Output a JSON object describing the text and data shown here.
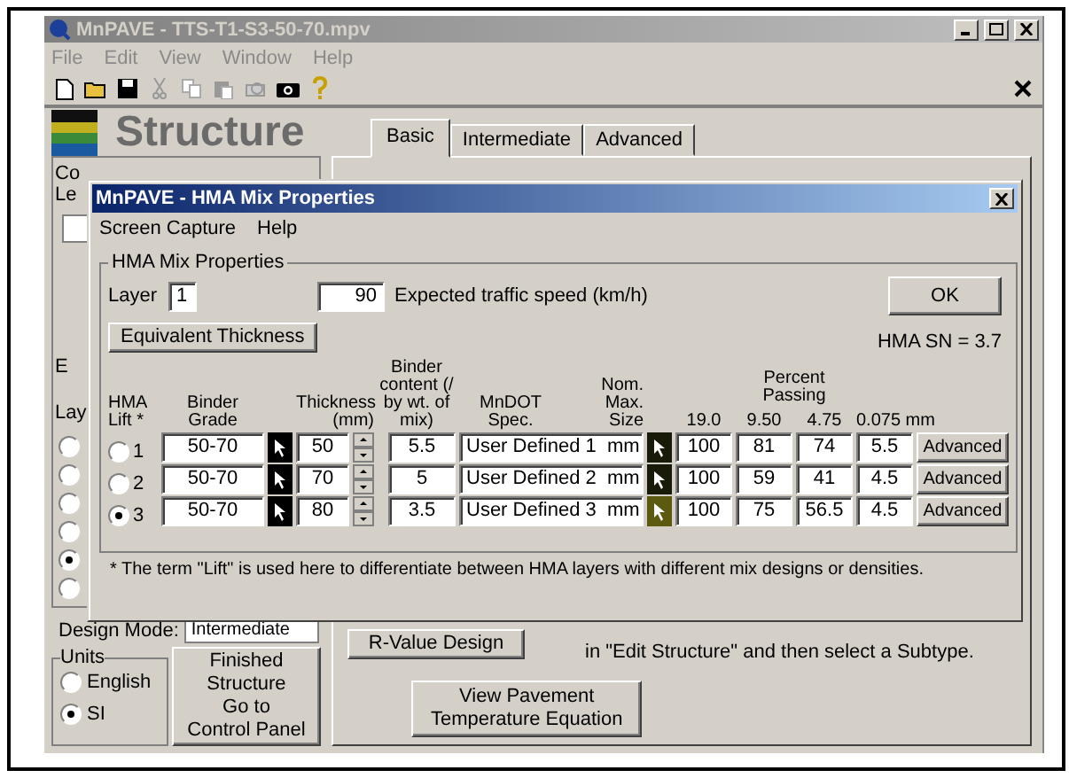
{
  "window": {
    "title": "MnPAVE - TTS-T1-S3-50-70.mpv"
  },
  "menu": [
    {
      "label": "File",
      "disabled": true
    },
    {
      "label": "Edit",
      "disabled": true
    },
    {
      "label": "View",
      "disabled": true
    },
    {
      "label": "Window",
      "disabled": true
    },
    {
      "label": "Help",
      "disabled": true
    }
  ],
  "structure": {
    "title": "Structure",
    "tabs": [
      {
        "label": "Basic",
        "selected": true
      },
      {
        "label": "Intermediate",
        "selected": false
      },
      {
        "label": "Advanced",
        "selected": false
      }
    ]
  },
  "left_panel": {
    "fragments": [
      "Co",
      "Le"
    ],
    "group_label": "E",
    "layer_label": "Lay",
    "radios": [
      {
        "selected": false
      },
      {
        "selected": false
      },
      {
        "selected": false
      },
      {
        "selected": false
      },
      {
        "selected": true
      },
      {
        "selected": false
      }
    ],
    "design_mode": {
      "label": "Design Mode:",
      "value": "Intermediate"
    },
    "units": {
      "label": "Units",
      "options": [
        {
          "label": "English",
          "selected": false
        },
        {
          "label": "SI",
          "selected": true
        }
      ]
    },
    "finished_button": [
      "Finished Structure",
      "Go to",
      "Control Panel"
    ]
  },
  "right_panel": {
    "r_value_button": "R-Value Design",
    "hint": "in \"Edit Structure\" and then select a Subtype.",
    "temperature_button": [
      "View Pavement",
      "Temperature Equation"
    ]
  },
  "dialog": {
    "title": "MnPAVE - HMA Mix Properties",
    "menu": [
      "Screen Capture",
      "Help"
    ],
    "group_label": "HMA Mix Properties",
    "layer_label": "Layer",
    "layer": "1",
    "speed": "90",
    "speed_label": "Expected traffic speed (km/h)",
    "ok": "OK",
    "equivalent_button": "Equivalent Thickness",
    "sn": "HMA SN = 3.7",
    "headers": {
      "lift": [
        "HMA",
        "Lift *"
      ],
      "grade": [
        "Binder",
        "Grade"
      ],
      "thickness": [
        "Thickness",
        "(mm)"
      ],
      "content": [
        "Binder",
        "content (/",
        "by wt. of",
        "mix)"
      ],
      "spec": [
        "MnDOT",
        "Spec."
      ],
      "size": [
        "Nom. Max.",
        "Size"
      ],
      "passing": "Percent Passing",
      "sieves": [
        "19.0",
        "9.50",
        "4.75",
        "0.075 mm"
      ]
    },
    "rows": [
      {
        "selected": false,
        "lift": "1",
        "grade": "50-70",
        "thickness": "50",
        "content": "5.5",
        "spec": "User Defined 1  mm",
        "passing": [
          "100",
          "81",
          "74",
          "5.5"
        ],
        "button": "Advanced"
      },
      {
        "selected": false,
        "lift": "2",
        "grade": "50-70",
        "thickness": "70",
        "content": "5",
        "spec": "User Defined 2  mm",
        "passing": [
          "100",
          "59",
          "41",
          "4.5"
        ],
        "button": "Advanced"
      },
      {
        "selected": true,
        "lift": "3",
        "grade": "50-70",
        "thickness": "80",
        "content": "3.5",
        "spec": "User Defined 3  mm",
        "passing": [
          "100",
          "75",
          "56.5",
          "4.5"
        ],
        "button": "Advanced"
      }
    ],
    "footnote": "* The term \"Lift\" is used here to differentiate between HMA layers with different mix designs or densities."
  }
}
